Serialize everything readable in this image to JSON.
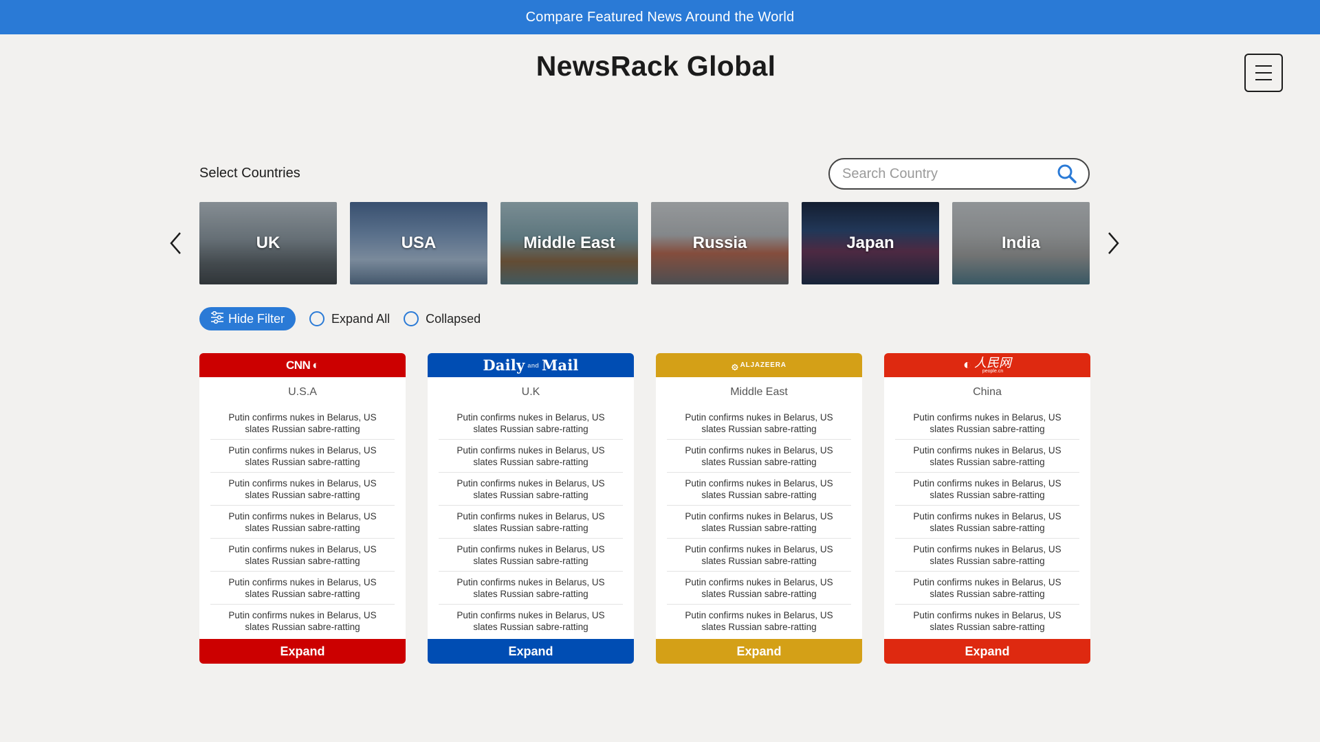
{
  "banner": {
    "text": "Compare Featured News Around the World"
  },
  "header": {
    "title": "NewsRack Global",
    "menu_icon": "hamburger-menu-icon"
  },
  "countries": {
    "label": "Select Countries",
    "search_placeholder": "Search Country",
    "tiles": [
      {
        "name": "UK"
      },
      {
        "name": "USA"
      },
      {
        "name": "Middle East"
      },
      {
        "name": "Russia"
      },
      {
        "name": "Japan"
      },
      {
        "name": "India"
      }
    ]
  },
  "filters": {
    "hide_filter_label": "Hide Filter",
    "expand_all_label": "Expand All",
    "collapsed_label": "Collapsed"
  },
  "colors": {
    "accent": "#2a7ad6",
    "cnn": "#cc0000",
    "dailymail": "#004db3",
    "aljazeera": "#d4a017",
    "people": "#de2910"
  },
  "cards": [
    {
      "source_logo": {
        "main": "CNN",
        "mark": "◐"
      },
      "country": "U.S.A",
      "headlines": [
        "Putin confirms nukes in Belarus, US slates Russian sabre-ratting",
        "Putin confirms nukes in Belarus, US slates Russian sabre-ratting",
        "Putin confirms nukes in Belarus, US slates Russian sabre-ratting",
        "Putin confirms nukes in Belarus, US slates Russian sabre-ratting",
        "Putin confirms nukes in Belarus, US slates Russian sabre-ratting",
        "Putin confirms nukes in Belarus, US slates Russian sabre-ratting",
        "Putin confirms nukes in Belarus, US slates Russian sabre-ratting"
      ],
      "expand_label": "Expand"
    },
    {
      "source_logo": {
        "left": "Daily",
        "mid": "and",
        "right": "Mail"
      },
      "country": "U.K",
      "headlines": [
        "Putin confirms nukes in Belarus, US slates Russian sabre-ratting",
        "Putin confirms nukes in Belarus, US slates Russian sabre-ratting",
        "Putin confirms nukes in Belarus, US slates Russian sabre-ratting",
        "Putin confirms nukes in Belarus, US slates Russian sabre-ratting",
        "Putin confirms nukes in Belarus, US slates Russian sabre-ratting",
        "Putin confirms nukes in Belarus, US slates Russian sabre-ratting",
        "Putin confirms nukes in Belarus, US slates Russian sabre-ratting"
      ],
      "expand_label": "Expand"
    },
    {
      "source_logo": {
        "mark": "۞",
        "main": "ALJAZEERA"
      },
      "country": "Middle East",
      "headlines": [
        "Putin confirms nukes in Belarus, US slates Russian sabre-ratting",
        "Putin confirms nukes in Belarus, US slates Russian sabre-ratting",
        "Putin confirms nukes in Belarus, US slates Russian sabre-ratting",
        "Putin confirms nukes in Belarus, US slates Russian sabre-ratting",
        "Putin confirms nukes in Belarus, US slates Russian sabre-ratting",
        "Putin confirms nukes in Belarus, US slates Russian sabre-ratting",
        "Putin confirms nukes in Belarus, US slates Russian sabre-ratting"
      ],
      "expand_label": "Expand"
    },
    {
      "source_logo": {
        "mark": "◐",
        "cn": "人民网",
        "sub": "people.cn"
      },
      "country": "China",
      "headlines": [
        "Putin confirms nukes in Belarus, US slates Russian sabre-ratting",
        "Putin confirms nukes in Belarus, US slates Russian sabre-ratting",
        "Putin confirms nukes in Belarus, US slates Russian sabre-ratting",
        "Putin confirms nukes in Belarus, US slates Russian sabre-ratting",
        "Putin confirms nukes in Belarus, US slates Russian sabre-ratting",
        "Putin confirms nukes in Belarus, US slates Russian sabre-ratting",
        "Putin confirms nukes in Belarus, US slates Russian sabre-ratting"
      ],
      "expand_label": "Expand"
    }
  ]
}
